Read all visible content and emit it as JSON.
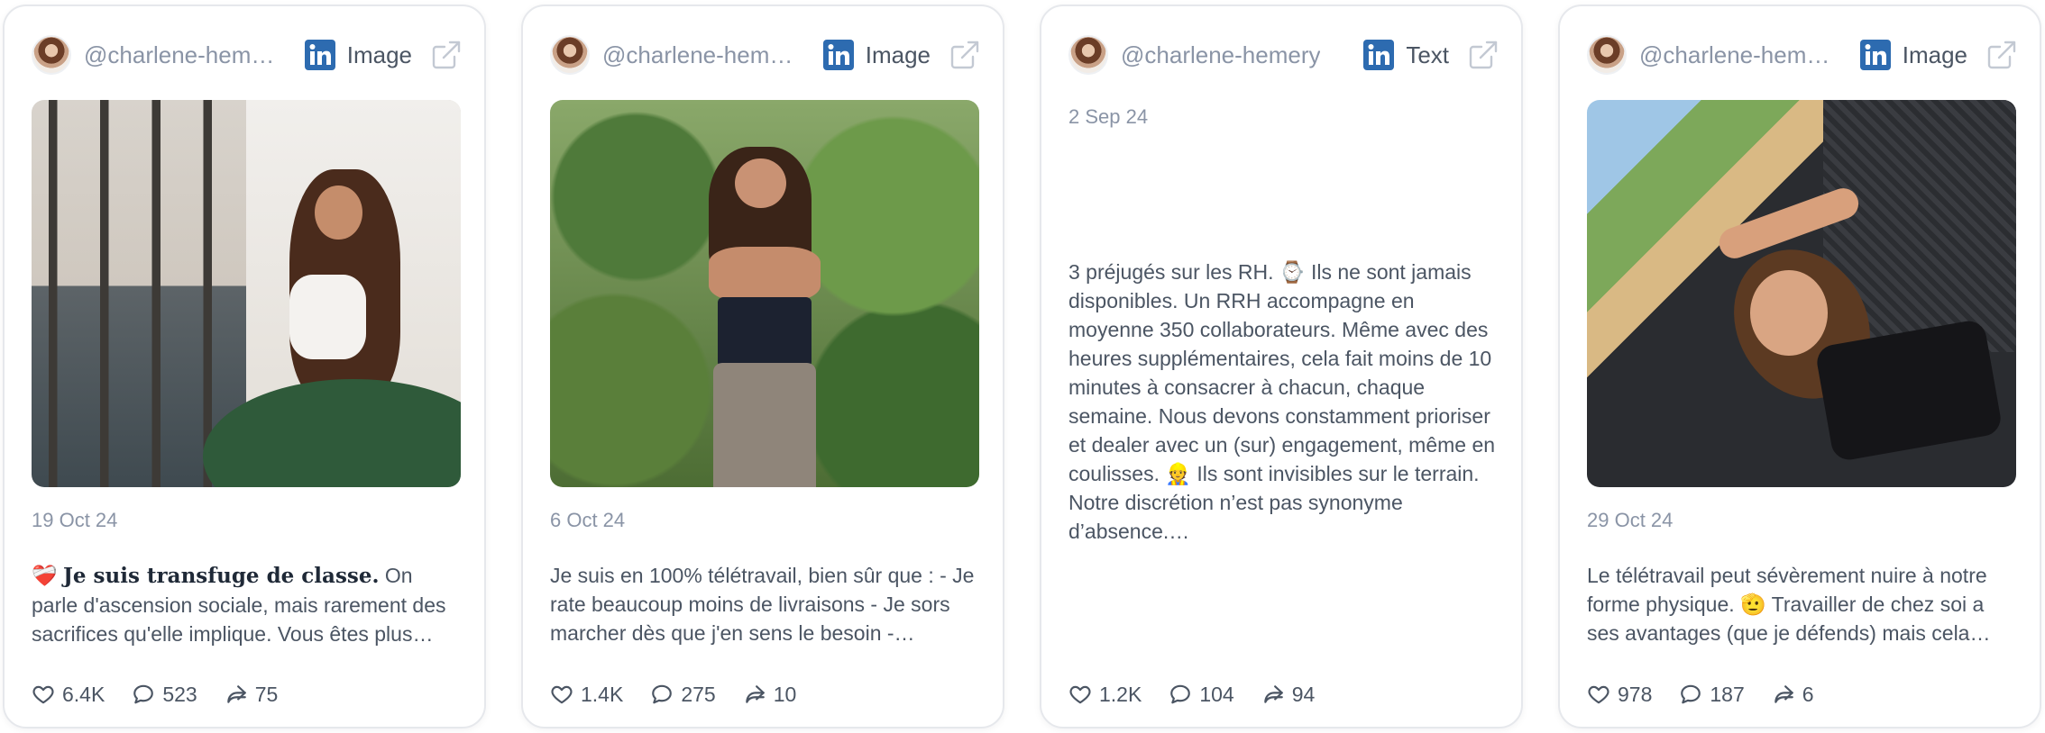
{
  "cards": [
    {
      "handle": "@charlene-hemery",
      "type_label": "Image",
      "date": "19 Oct 24",
      "text_emoji": "❤️‍🩹",
      "text_bold": "Je suis transfuge de classe.",
      "text_rest": " On parle d'ascension sociale, mais rarement des sacrifices qu'elle implique. Vous êtes plus…",
      "likes": "6.4K",
      "comments": "523",
      "shares": "75"
    },
    {
      "handle": "@charlene-hemery",
      "type_label": "Image",
      "date": "6 Oct 24",
      "text_rest": "Je suis en 100% télétravail, bien sûr que : - Je rate beaucoup moins de livraisons - Je sors marcher dès que j'en sens le besoin -…",
      "likes": "1.4K",
      "comments": "275",
      "shares": "10"
    },
    {
      "handle": "@charlene-hemery",
      "type_label": "Text",
      "date": "2 Sep 24",
      "text_rest": "3 préjugés sur les RH. ⌚ Ils ne sont jamais disponibles. Un RRH accompagne en moyenne 350 collaborateurs. Même avec des heures supplémentaires, cela fait moins de 10 minutes à consacrer à chacun, chaque semaine. Nous devons constamment prioriser et dealer avec un (sur) engagement, même en coulisses. 👷 Ils sont invisibles sur le terrain. Notre discrétion n’est pas synonyme d’absence.…",
      "likes": "1.2K",
      "comments": "104",
      "shares": "94"
    },
    {
      "handle": "@charlene-hemery",
      "type_label": "Image",
      "date": "29 Oct 24",
      "text_rest": "Le télétravail peut sévèrement nuire à notre forme physique. 🫡 Travailler de chez soi a ses avantages (que je défends) mais cela…",
      "likes": "978",
      "comments": "187",
      "shares": "6"
    }
  ],
  "icons": {
    "network": "linkedin-icon",
    "open": "external-link-icon",
    "like": "heart-icon",
    "comment": "comment-icon",
    "share": "share-icon"
  },
  "colors": {
    "linkedin": "#2d6bb0",
    "muted": "#8a94a6",
    "text": "#4b5563",
    "border": "#e6e8ec"
  }
}
